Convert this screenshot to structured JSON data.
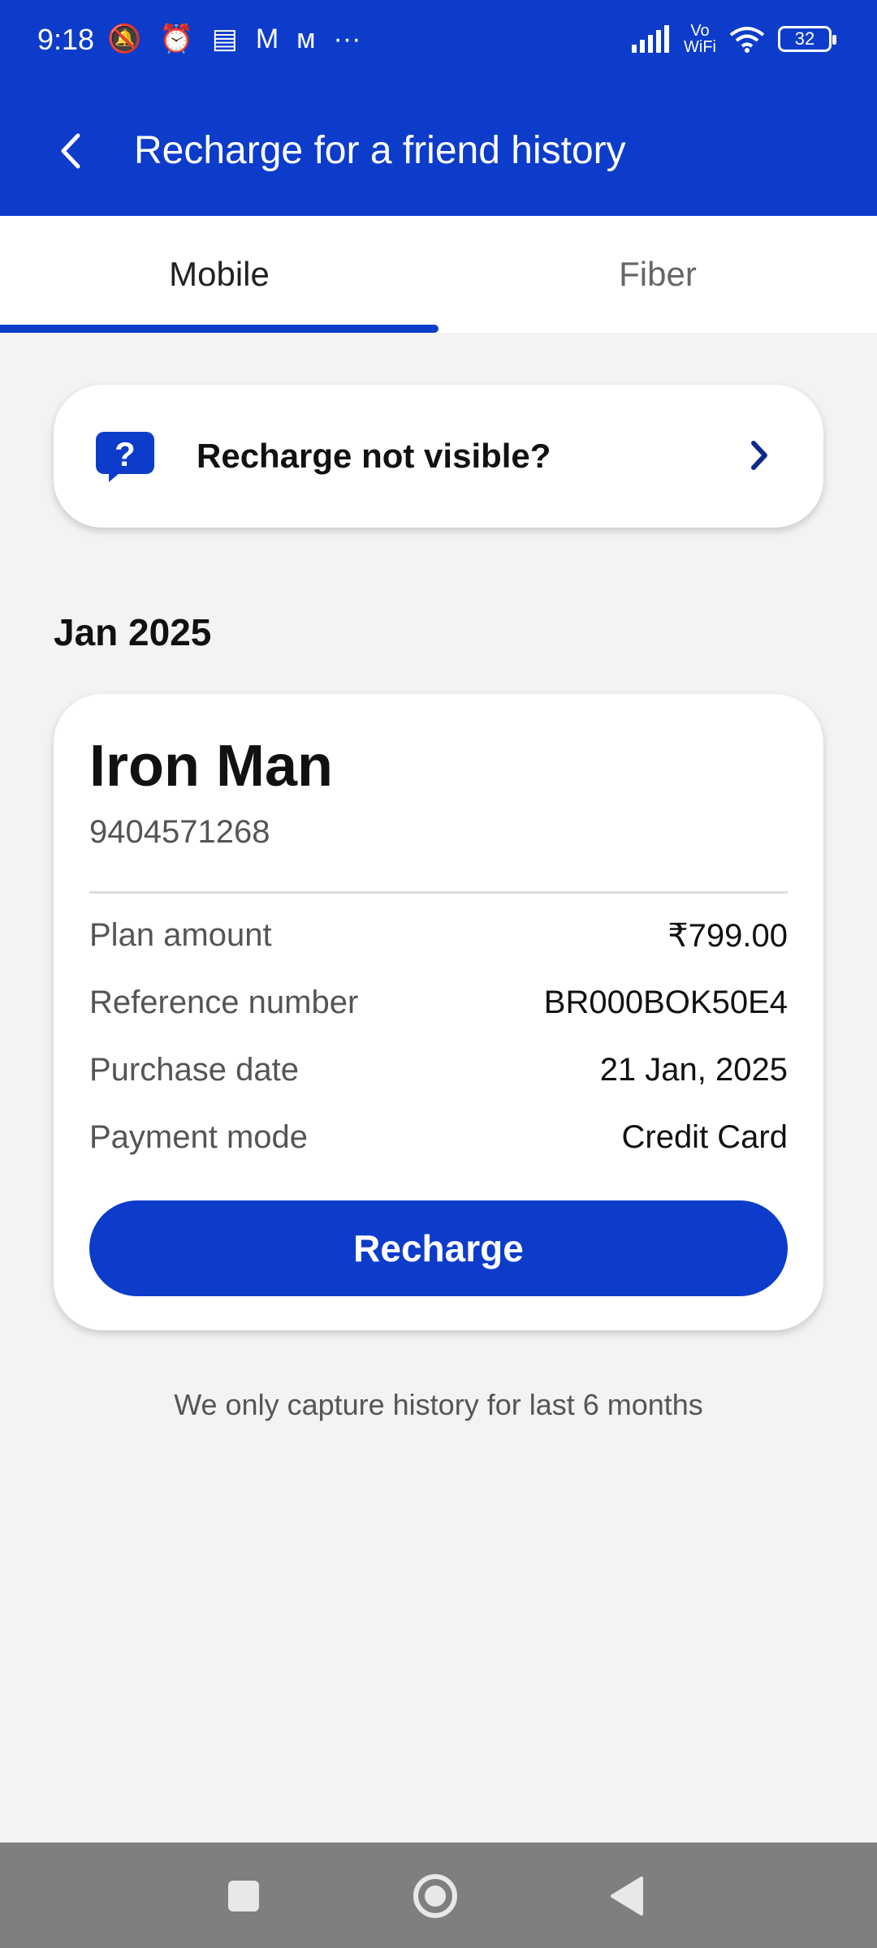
{
  "status_bar": {
    "time": "9:18",
    "left_icons": [
      "mute-icon",
      "alarm-icon",
      "message-icon",
      "gmail-icon",
      "myntra-icon",
      "more-dots-icon"
    ],
    "network_label": "Vo WiFi",
    "battery": "32"
  },
  "header": {
    "title": "Recharge for a friend history"
  },
  "tabs": [
    {
      "label": "Mobile",
      "active": true
    },
    {
      "label": "Fiber",
      "active": false
    }
  ],
  "help_card": {
    "text": "Recharge not visible?"
  },
  "history": {
    "month": "Jan 2025",
    "entry": {
      "name": "Iron Man",
      "phone": "9404571268",
      "rows": [
        {
          "label": "Plan amount",
          "value": "₹799.00"
        },
        {
          "label": "Reference number",
          "value": "BR000BOK50E4"
        },
        {
          "label": "Purchase date",
          "value": "21 Jan, 2025"
        },
        {
          "label": "Payment mode",
          "value": "Credit Card"
        }
      ],
      "button_label": "Recharge"
    }
  },
  "footer_note": "We only capture history for last 6 months",
  "colors": {
    "brand": "#0d3ccb",
    "background": "#f3f3f3",
    "nav_bar": "#7f7f7f"
  }
}
